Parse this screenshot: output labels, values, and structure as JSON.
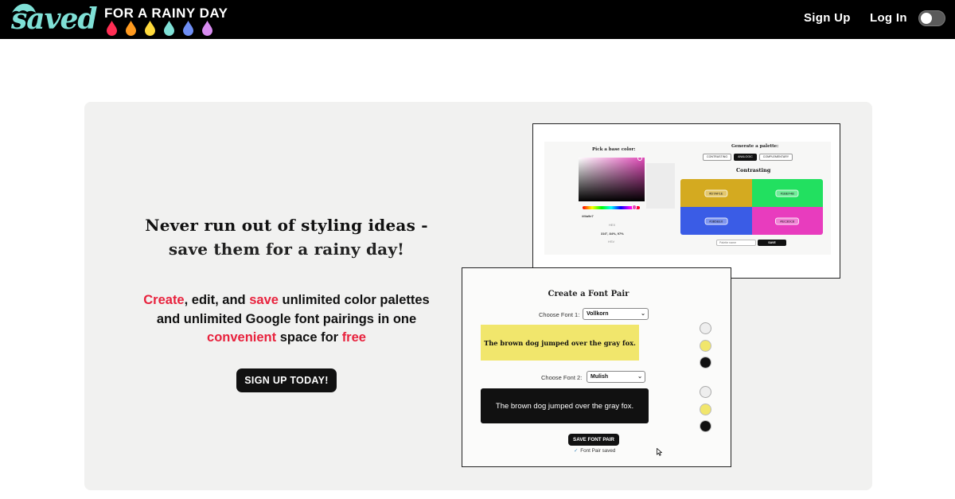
{
  "brand": {
    "logo_word": "saved",
    "tagline": "FOR A RAINY DAY",
    "drop_colors": [
      "#ff2e54",
      "#ff9a1f",
      "#ffd93b",
      "#7fe0d6",
      "#6f8ff5",
      "#d88cf0"
    ],
    "logo_color": "#7fe0d6"
  },
  "nav": {
    "signup": "Sign Up",
    "login": "Log In",
    "theme_toggle_state": "off"
  },
  "hero": {
    "headline_line1": "Never run out of styling ideas -",
    "headline_line2": "save them for a rainy day!",
    "sub_create": "Create",
    "sub_part1": ", edit, and ",
    "sub_save": "save",
    "sub_part2": " unlimited color palettes and unlimited Google font pairings in one ",
    "sub_convenient": "convenient",
    "sub_part3": " space for ",
    "sub_free": "free",
    "cta": "SIGN UP TODAY!",
    "accent_color": "#e8223d"
  },
  "palette_shot": {
    "pick_label": "Pick a base color:",
    "generate_label": "Generate a palette:",
    "tabs": [
      "CONTRASTING",
      "ANALOGIC",
      "COMPLEMENTARY"
    ],
    "active_tab": "ANALOGIC",
    "result_title": "Contrasting",
    "hex_value": "#f4a9e7",
    "hex_label": "HEX",
    "hsl_value": "316°, 84%, 97%",
    "hsl_label": "HSV",
    "swatches": [
      {
        "color": "#d4aa20",
        "hex": "#D7AF1E"
      },
      {
        "color": "#22e060",
        "hex": "#1BEF4B"
      },
      {
        "color": "#3a5ce6",
        "hex": "#3B5EE0"
      },
      {
        "color": "#e83cbe",
        "hex": "#EC3DC8"
      }
    ],
    "input_placeholder": "Palette name",
    "save": "SAVE"
  },
  "font_shot": {
    "title": "Create a Font Pair",
    "font1_label": "Choose Font 1:",
    "font1_value": "Vollkorn",
    "font2_label": "Choose Font 2:",
    "font2_value": "Mulish",
    "sample": "The brown dog jumped over the gray fox.",
    "preview1_bg": "#f1e66c",
    "preview2_bg": "#111111",
    "circles_top": [
      "#eeeeee",
      "#f1e66c",
      "#111111"
    ],
    "circles_bottom": [
      "#eeeeee",
      "#f1e66c",
      "#111111"
    ],
    "save": "SAVE FONT PAIR",
    "saved_msg": "Font Pair saved"
  }
}
